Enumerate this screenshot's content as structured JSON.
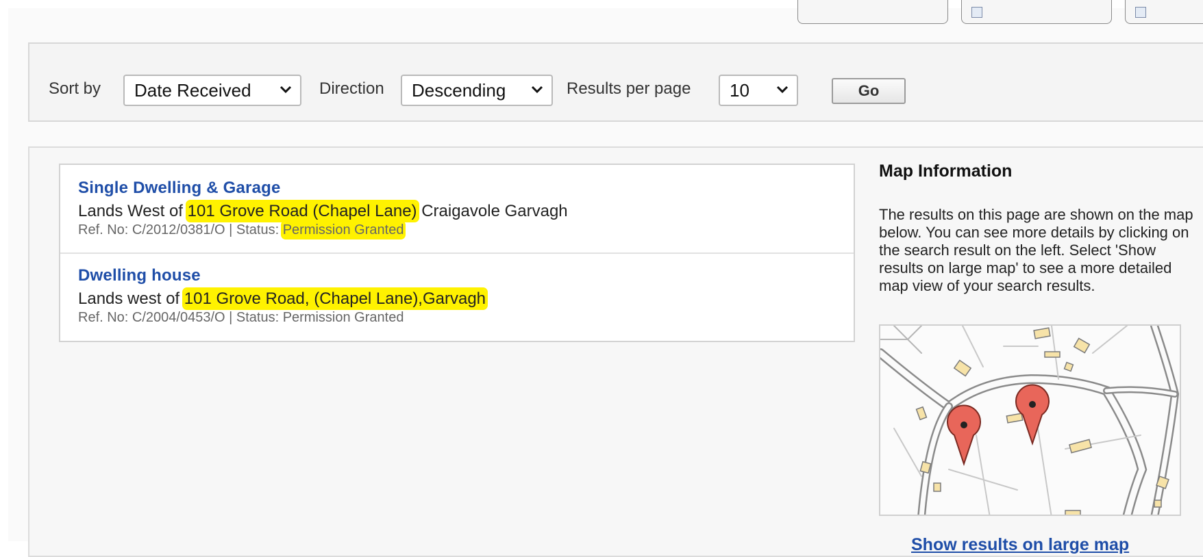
{
  "sort_bar": {
    "sort_by_label": "Sort by",
    "sort_by_value": "Date Received",
    "direction_label": "Direction",
    "direction_value": "Descending",
    "results_per_page_label": "Results per page",
    "results_per_page_value": "10",
    "go_label": "Go"
  },
  "results": [
    {
      "title": "Single Dwelling & Garage",
      "address_prefix": "Lands West of ",
      "address_highlight": "101 Grove Road (Chapel Lane)",
      "address_suffix": " Craigavole Garvagh",
      "meta_prefix": "Ref. No: C/2012/0381/O | Status: ",
      "meta_status": "Permission Granted"
    },
    {
      "title": "Dwelling house",
      "address_prefix": "Lands west of ",
      "address_highlight": "101 Grove Road, (Chapel Lane),Garvagh",
      "address_suffix": "",
      "meta_prefix": "Ref. No: C/2004/0453/O | Status: ",
      "meta_status": "Permission Granted"
    }
  ],
  "map_info": {
    "heading": "Map Information",
    "description": "The results on this page are shown on the map below. You can see more details by clicking on the search result on the left. Select 'Show results on large map' to see a more detailed map view of your search results.",
    "link_label": "Show results on large map",
    "marker_color": "#e8665a"
  },
  "colors": {
    "link": "#1f4ea8",
    "highlight": "#fff200"
  }
}
